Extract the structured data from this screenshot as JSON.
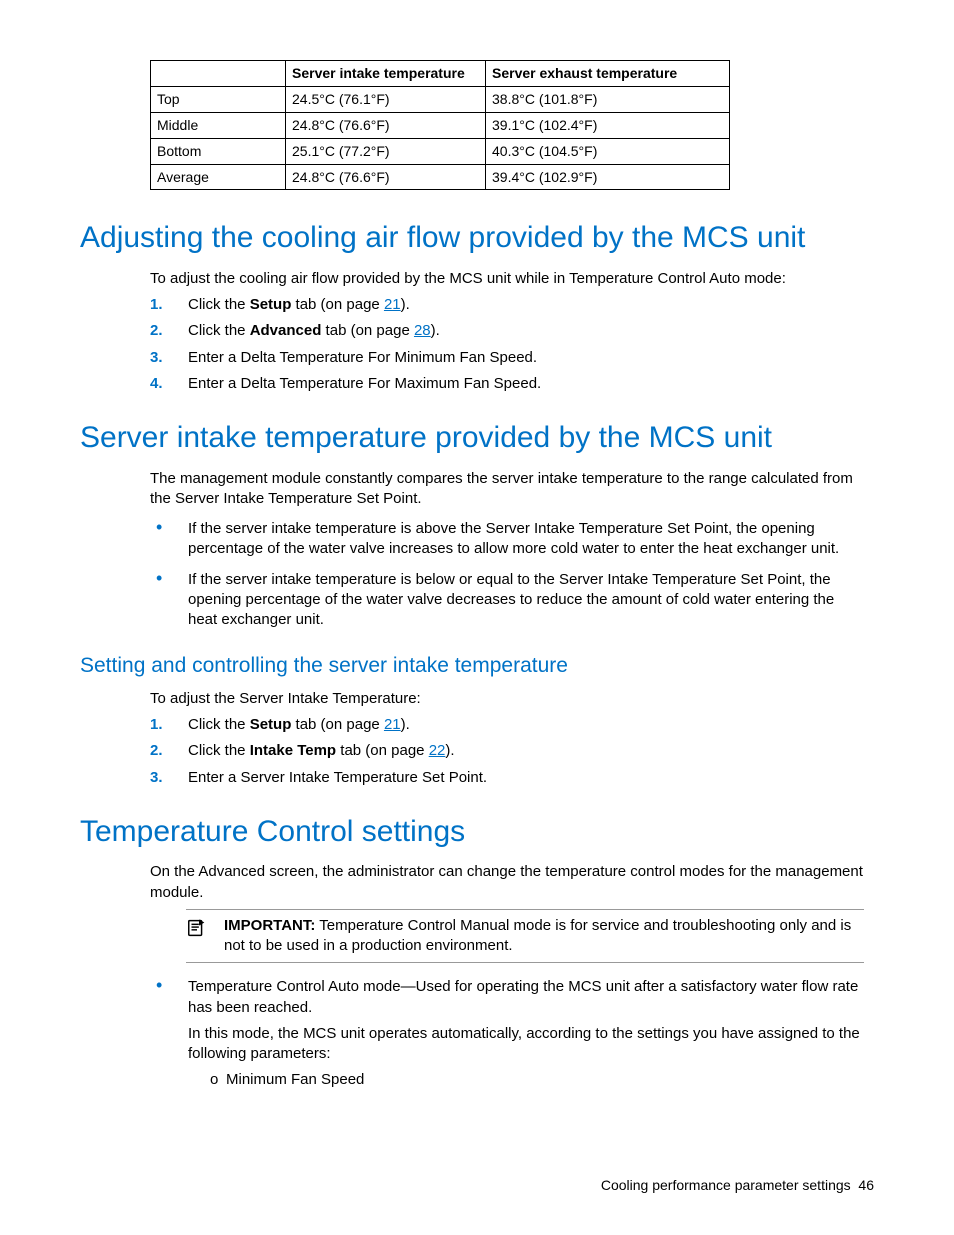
{
  "table": {
    "headers": [
      "",
      "Server intake temperature",
      "Server exhaust temperature"
    ],
    "rows": [
      {
        "label": "Top",
        "intake": "24.5°C (76.1°F)",
        "exhaust": "38.8°C (101.8°F)"
      },
      {
        "label": "Middle",
        "intake": "24.8°C (76.6°F)",
        "exhaust": "39.1°C (102.4°F)"
      },
      {
        "label": "Bottom",
        "intake": "25.1°C (77.2°F)",
        "exhaust": "40.3°C (104.5°F)"
      },
      {
        "label": "Average",
        "intake": "24.8°C (76.6°F)",
        "exhaust": "39.4°C (102.9°F)"
      }
    ]
  },
  "h_adjust": "Adjusting the cooling air flow provided by the MCS unit",
  "p_adjust_intro": "To adjust the cooling air flow provided by the MCS unit while in Temperature Control Auto mode:",
  "steps_adjust": {
    "s1_a": "Click the ",
    "s1_bold": "Setup",
    "s1_b": " tab (on page ",
    "s1_link": "21",
    "s1_c": ").",
    "s2_a": "Click the ",
    "s2_bold": "Advanced",
    "s2_b": " tab (on page ",
    "s2_link": "28",
    "s2_c": ").",
    "s3": "Enter a Delta Temperature For Minimum Fan Speed.",
    "s4": "Enter a Delta Temperature For Maximum Fan Speed."
  },
  "h_intake": "Server intake temperature provided by the MCS unit",
  "p_intake_intro": "The management module constantly compares the server intake temperature to the range calculated from the Server Intake Temperature Set Point.",
  "bullets_intake": [
    "If the server intake temperature is above the Server Intake Temperature Set Point, the opening percentage of the water valve increases to allow more cold water to enter the heat exchanger unit.",
    "If the server intake temperature is below or equal to the Server Intake Temperature Set Point, the opening percentage of the water valve decreases to reduce the amount of cold water entering the heat exchanger unit."
  ],
  "h_setting": "Setting and controlling the server intake temperature",
  "p_setting_intro": "To adjust the Server Intake Temperature:",
  "steps_setting": {
    "s1_a": "Click the ",
    "s1_bold": "Setup",
    "s1_b": " tab (on page ",
    "s1_link": "21",
    "s1_c": ").",
    "s2_a": "Click the ",
    "s2_bold": "Intake Temp",
    "s2_b": " tab (on page ",
    "s2_link": "22",
    "s2_c": ").",
    "s3": "Enter a Server Intake Temperature Set Point."
  },
  "h_tempctl": "Temperature Control settings",
  "p_tempctl_intro": "On the Advanced screen, the administrator can change the temperature control modes for the management module.",
  "callout": {
    "label": "IMPORTANT:",
    "text": "  Temperature Control Manual mode is for service and troubleshooting only and is not to be used in a production environment."
  },
  "tempctl_bullet": {
    "p1": "Temperature Control Auto mode—Used for operating the MCS unit after a satisfactory water flow rate has been reached.",
    "p2": "In this mode, the MCS unit operates automatically, according to the settings you have assigned to the following parameters:",
    "sub_o": "o",
    "sub_text": "Minimum Fan Speed"
  },
  "footer": {
    "section": "Cooling performance parameter settings",
    "page": "46"
  },
  "nums": {
    "n1": "1.",
    "n2": "2.",
    "n3": "3.",
    "n4": "4."
  }
}
